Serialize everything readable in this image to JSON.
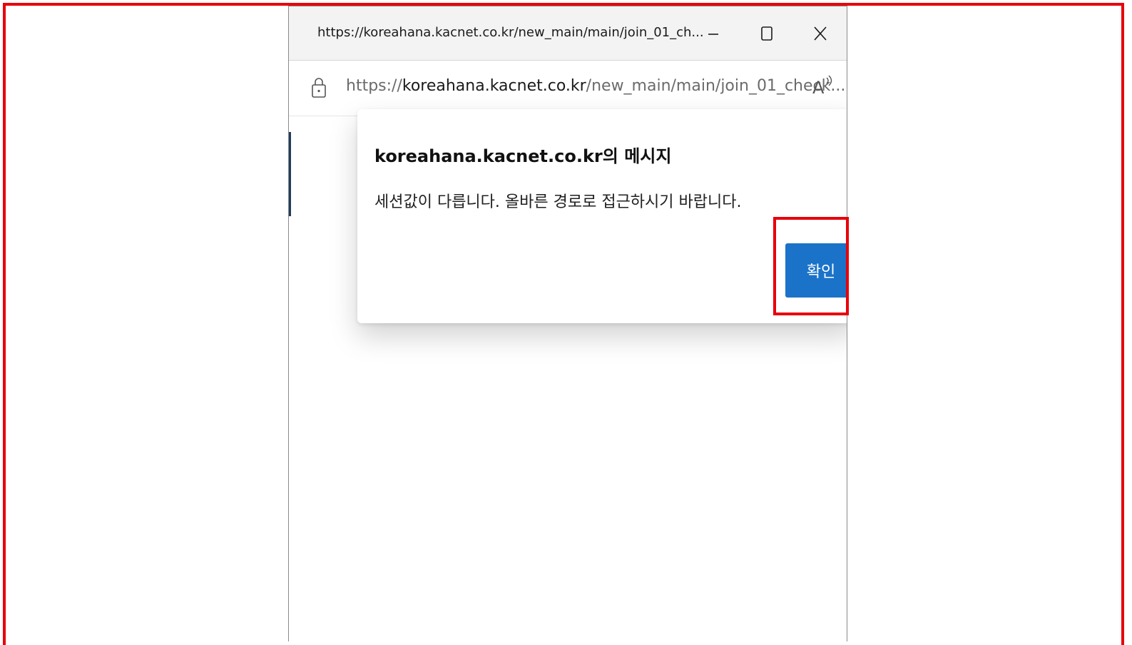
{
  "window": {
    "title": "https://koreahana.kacnet.co.kr/new_main/main/join_01_ch...",
    "controls": {
      "minimize_icon": "minimize-icon",
      "maximize_icon": "maximize-icon",
      "close_icon": "close-icon"
    }
  },
  "address_bar": {
    "url_scheme": "https://",
    "url_host": "koreahana.kacnet.co.kr",
    "url_path": "/new_main/main/join_01_check...",
    "lock_icon": "lock-icon",
    "read_aloud_icon": "read-aloud-icon"
  },
  "dialog": {
    "title": "koreahana.kacnet.co.kr의 메시지",
    "message": "세션값이 다릅니다. 올바른 경로로 접근하시기 바랍니다.",
    "confirm_label": "확인"
  },
  "colors": {
    "highlight": "#e8000b",
    "button_primary": "#1a73c9"
  }
}
